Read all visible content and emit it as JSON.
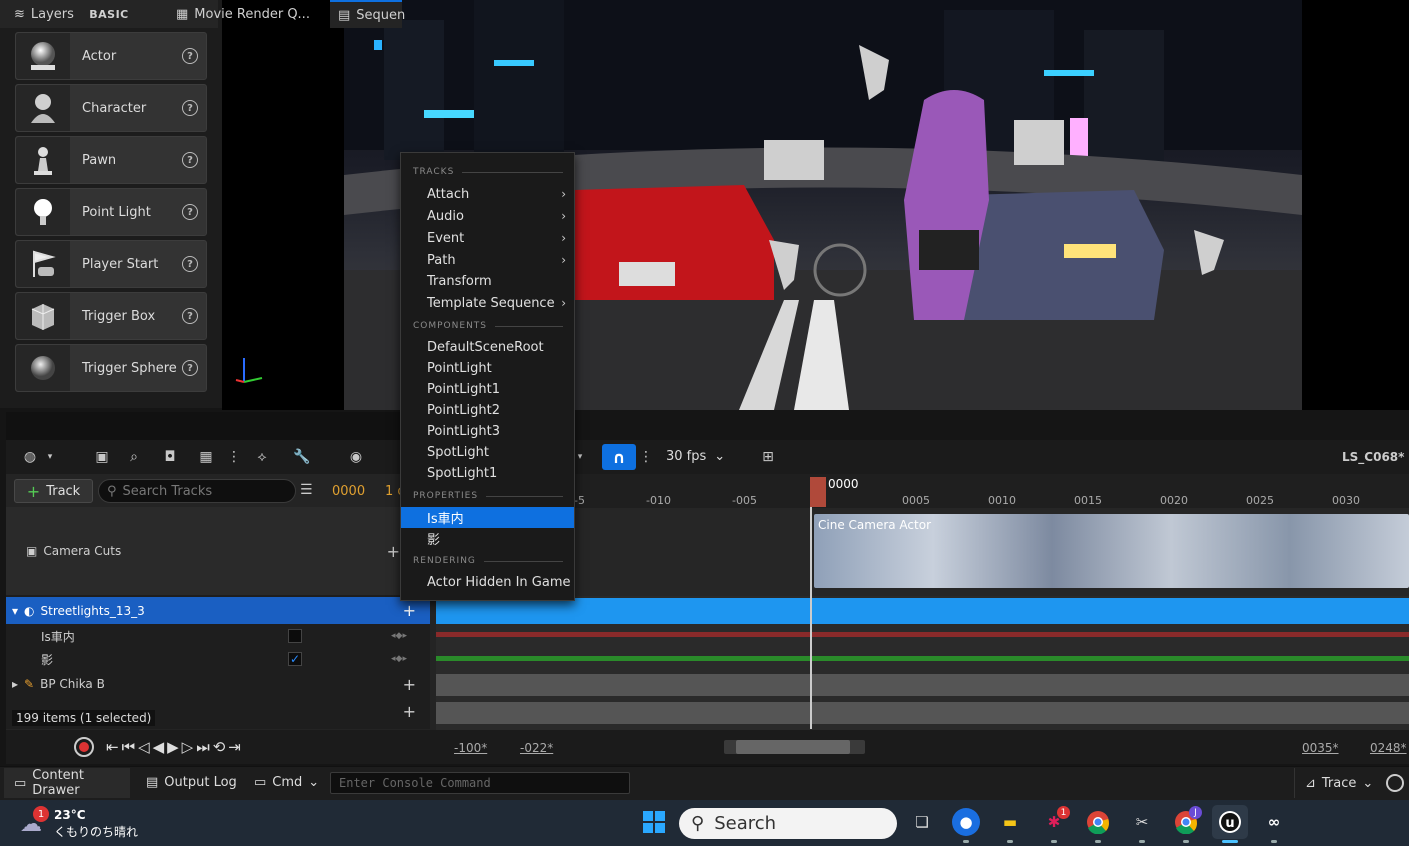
{
  "place_panel": {
    "header": "BASIC",
    "items": [
      {
        "label": "Actor",
        "icon": "actor-sphere-icon"
      },
      {
        "label": "Character",
        "icon": "character-icon"
      },
      {
        "label": "Pawn",
        "icon": "pawn-icon"
      },
      {
        "label": "Point Light",
        "icon": "point-light-icon"
      },
      {
        "label": "Player Start",
        "icon": "player-start-icon"
      },
      {
        "label": "Trigger Box",
        "icon": "trigger-box-icon"
      },
      {
        "label": "Trigger Sphere",
        "icon": "trigger-sphere-icon"
      }
    ],
    "help_glyph": "?"
  },
  "tabs": {
    "layers": "Layers",
    "movie_render": "Movie Render Q...",
    "sequencer": "Sequen"
  },
  "sequencer": {
    "track_button": "Track",
    "search_placeholder": "Search Tracks",
    "current_frame": "0000",
    "frame_partial": "1 o",
    "fps": "30 fps",
    "sequence_name": "LS_C068*",
    "playhead_label": "0000",
    "ruler_ticks": [
      "-5",
      "-010",
      "-005",
      "0005",
      "0010",
      "0015",
      "0020",
      "0025",
      "0030"
    ],
    "status": "199 items (1 selected)",
    "range_start_outer": "-100*",
    "range_start": "-022*",
    "range_end": "0035*",
    "range_end_outer": "0248*",
    "camera_clip_label": "Cine Camera Actor"
  },
  "tracks": [
    {
      "label": "Camera Cuts",
      "icon": "camera-cuts-icon"
    },
    {
      "label": "Streetlights_13_3",
      "icon": "actor-sphere-icon",
      "selected": true
    },
    {
      "label": "Is車内",
      "checked": false
    },
    {
      "label": "影",
      "checked": true
    },
    {
      "label": "BP Chika B",
      "icon": "blueprint-icon"
    }
  ],
  "context_menu": {
    "sections": {
      "tracks": "TRACKS",
      "components": "COMPONENTS",
      "properties": "PROPERTIES",
      "rendering": "RENDERING"
    },
    "track_items": [
      "Attach",
      "Audio",
      "Event",
      "Path",
      "Transform",
      "Template Sequence"
    ],
    "component_items": [
      "DefaultSceneRoot",
      "PointLight",
      "PointLight1",
      "PointLight2",
      "PointLight3",
      "SpotLight",
      "SpotLight1"
    ],
    "property_items": [
      "Is車内",
      "影"
    ],
    "rendering_items": [
      "Actor Hidden In Game"
    ],
    "highlighted": "Is車内"
  },
  "bottom_bar": {
    "content_drawer": "Content Drawer",
    "output_log": "Output Log",
    "cmd": "Cmd",
    "console_placeholder": "Enter Console Command",
    "trace": "Trace"
  },
  "taskbar": {
    "weather_temp": "23°C",
    "weather_desc": "くもりのち晴れ",
    "weather_badge": "1",
    "search": "Search",
    "slack_badge": "1",
    "chrome_badge": "J"
  },
  "colors": {
    "accent": "#0e70e0",
    "selected_row": "#1a5fc2",
    "playhead": "#b0493a",
    "clip_blue": "#1e96f0"
  }
}
